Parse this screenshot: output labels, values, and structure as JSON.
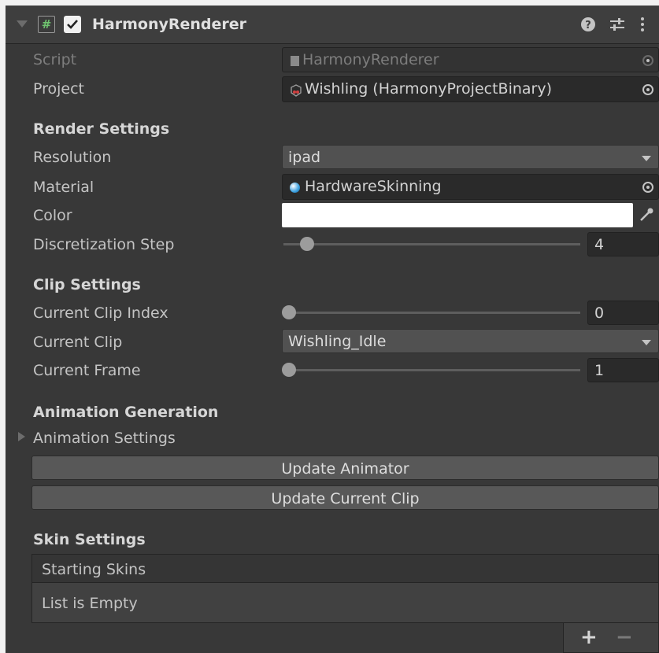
{
  "component": {
    "title": "HarmonyRenderer",
    "enabled": true,
    "icons": [
      "fold-arrow-icon",
      "script-hash-icon",
      "checkbox-checked-icon",
      "help-icon",
      "presets-icon",
      "more-menu-icon"
    ]
  },
  "fields": {
    "script": {
      "label": "Script",
      "value": "HarmonyRenderer"
    },
    "project": {
      "label": "Project",
      "value": "Wishling (HarmonyProjectBinary)"
    }
  },
  "render_settings": {
    "header": "Render Settings",
    "resolution": {
      "label": "Resolution",
      "value": "ipad"
    },
    "material": {
      "label": "Material",
      "value": "HardwareSkinning"
    },
    "color": {
      "label": "Color",
      "value": "#ffffff"
    },
    "discretization_step": {
      "label": "Discretization Step",
      "value": "4",
      "slider_fraction": 0.08
    }
  },
  "clip_settings": {
    "header": "Clip Settings",
    "current_clip_index": {
      "label": "Current Clip Index",
      "value": "0",
      "slider_fraction": 0.0
    },
    "current_clip": {
      "label": "Current Clip",
      "value": "Wishling_Idle"
    },
    "current_frame": {
      "label": "Current Frame",
      "value": "1",
      "slider_fraction": 0.0
    }
  },
  "animation_generation": {
    "header": "Animation Generation",
    "foldout": "Animation Settings",
    "update_animator": "Update Animator",
    "update_current_clip": "Update Current Clip"
  },
  "skin_settings": {
    "header": "Skin Settings",
    "list_title": "Starting Skins",
    "empty_text": "List is Empty",
    "add": "+",
    "remove": "−"
  },
  "colors": {
    "panel_bg": "#383838",
    "field_bg": "#2a2a2a",
    "button_bg": "#585858",
    "dropdown_bg": "#515151",
    "accent_blue": "#3aa0e0"
  }
}
